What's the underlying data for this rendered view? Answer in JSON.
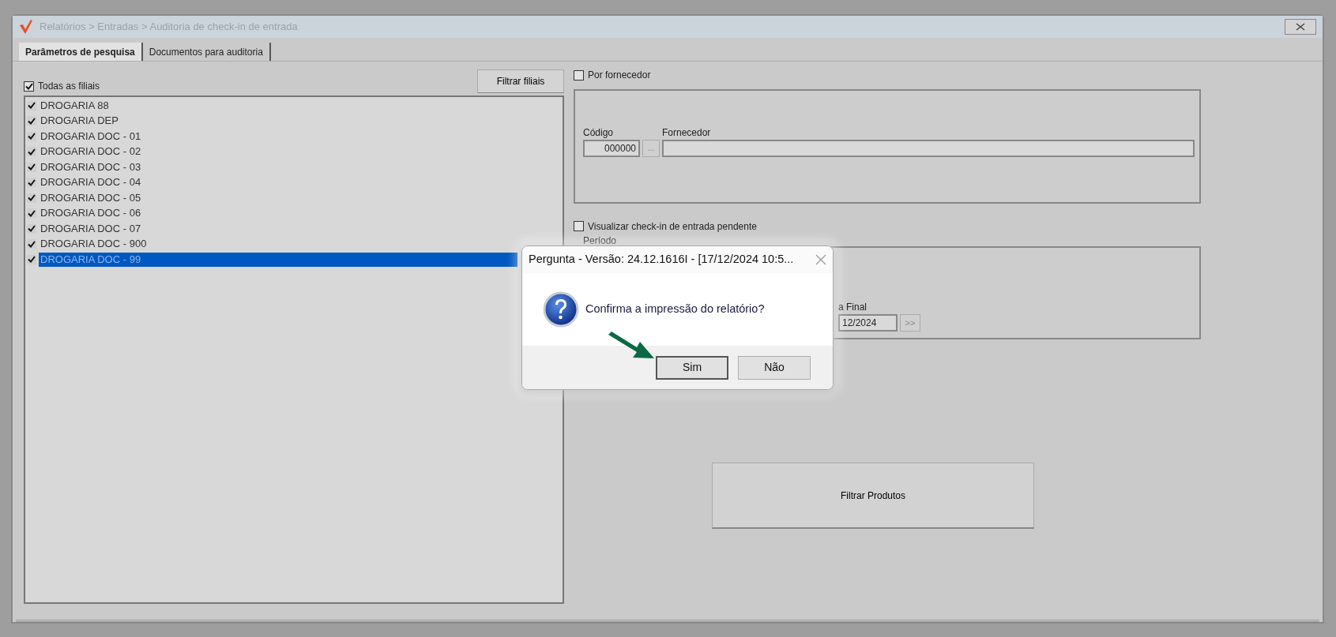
{
  "window": {
    "title": "Relatórios > Entradas > Auditoria de check-in de entrada"
  },
  "tabs": [
    {
      "label": "Parâmetros de pesquisa",
      "selected": true
    },
    {
      "label": "Documentos para auditoria",
      "selected": false
    }
  ],
  "branches": {
    "all": {
      "label": "Todas as filiais",
      "checked": true
    },
    "filter_button": "Filtrar filiais",
    "items": [
      {
        "label": "DROGARIA 88",
        "checked": true,
        "selected": false
      },
      {
        "label": "DROGARIA DEP",
        "checked": true,
        "selected": false
      },
      {
        "label": "DROGARIA DOC - 01",
        "checked": true,
        "selected": false
      },
      {
        "label": "DROGARIA DOC - 02",
        "checked": true,
        "selected": false
      },
      {
        "label": "DROGARIA DOC - 03",
        "checked": true,
        "selected": false
      },
      {
        "label": "DROGARIA DOC - 04",
        "checked": true,
        "selected": false
      },
      {
        "label": "DROGARIA DOC - 05",
        "checked": true,
        "selected": false
      },
      {
        "label": "DROGARIA DOC - 06",
        "checked": true,
        "selected": false
      },
      {
        "label": "DROGARIA DOC - 07",
        "checked": true,
        "selected": false
      },
      {
        "label": "DROGARIA DOC - 900",
        "checked": true,
        "selected": false
      },
      {
        "label": "DROGARIA DOC - 99",
        "checked": true,
        "selected": true
      }
    ]
  },
  "supplier": {
    "checkbox": {
      "label": "Por fornecedor",
      "checked": false
    },
    "code_label": "Código",
    "code_value": "000000",
    "browse_button": "...",
    "supplier_label": "Fornecedor"
  },
  "pending": {
    "label": "Visualizar check-in de entrada pendente",
    "checked": false
  },
  "period": {
    "title": "Período",
    "end_label": "a Final",
    "end_value": "12/2024",
    "next_button": ">>"
  },
  "filter_products_button": "Filtrar Produtos",
  "dialog": {
    "title": "Pergunta - Versão: 24.12.1616I - [17/12/2024 10:5...",
    "message": "Confirma a impressão do relatório?",
    "buttons": [
      {
        "label": "Sim",
        "selected": true
      },
      {
        "label": "Não",
        "selected": false
      }
    ]
  }
}
